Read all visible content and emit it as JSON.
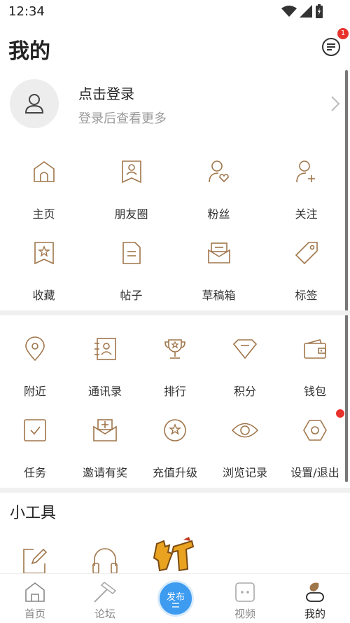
{
  "status_bar": {
    "time": "12:34"
  },
  "header": {
    "title": "我的",
    "message_badge": "1"
  },
  "login": {
    "title": "点击登录",
    "subtitle": "登录后查看更多"
  },
  "menu_primary": [
    {
      "label": "主页",
      "icon": "home-icon"
    },
    {
      "label": "朋友圈",
      "icon": "profile-card-icon"
    },
    {
      "label": "粉丝",
      "icon": "user-heart-icon"
    },
    {
      "label": "关注",
      "icon": "user-plus-icon"
    },
    {
      "label": "收藏",
      "icon": "star-bookmark-icon"
    },
    {
      "label": "帖子",
      "icon": "document-icon"
    },
    {
      "label": "草稿箱",
      "icon": "draft-box-icon"
    },
    {
      "label": "标签",
      "icon": "tag-icon"
    }
  ],
  "menu_secondary": [
    {
      "label": "附近",
      "icon": "location-pin-icon"
    },
    {
      "label": "通讯录",
      "icon": "contacts-icon"
    },
    {
      "label": "排行",
      "icon": "trophy-icon"
    },
    {
      "label": "积分",
      "icon": "diamond-icon"
    },
    {
      "label": "钱包",
      "icon": "wallet-icon"
    },
    {
      "label": "任务",
      "icon": "task-check-icon"
    },
    {
      "label": "邀请有奖",
      "icon": "invite-envelope-icon"
    },
    {
      "label": "充值升级",
      "icon": "upgrade-star-icon"
    },
    {
      "label": "浏览记录",
      "icon": "eye-icon"
    },
    {
      "label": "设置/退出",
      "icon": "settings-hexagon-icon"
    }
  ],
  "tools": {
    "title": "小工具",
    "items": [
      "edit-icon",
      "headphones-icon",
      "game-logo-icon"
    ]
  },
  "tabbar": {
    "items": [
      {
        "label": "首页",
        "icon": "house-icon"
      },
      {
        "label": "论坛",
        "icon": "hammer-icon"
      },
      {
        "label": "视频",
        "icon": "video-icon"
      },
      {
        "label": "我的",
        "icon": "me-icon"
      }
    ],
    "publish_label": "发布"
  },
  "colors": {
    "accent": "#a0764b",
    "badge": "#e8322c",
    "publish": "#3d9bf0"
  }
}
